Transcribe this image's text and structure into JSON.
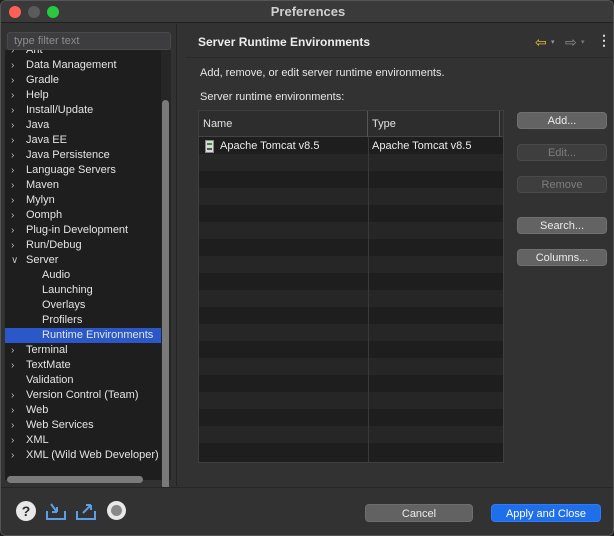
{
  "window": {
    "title": "Preferences"
  },
  "filter": {
    "placeholder": "type filter text"
  },
  "tree": {
    "items": [
      {
        "label": "Ant",
        "expandable": true,
        "level": 0
      },
      {
        "label": "Data Management",
        "expandable": true,
        "level": 0
      },
      {
        "label": "Gradle",
        "expandable": true,
        "level": 0
      },
      {
        "label": "Help",
        "expandable": true,
        "level": 0
      },
      {
        "label": "Install/Update",
        "expandable": true,
        "level": 0
      },
      {
        "label": "Java",
        "expandable": true,
        "level": 0
      },
      {
        "label": "Java EE",
        "expandable": true,
        "level": 0
      },
      {
        "label": "Java Persistence",
        "expandable": true,
        "level": 0
      },
      {
        "label": "Language Servers",
        "expandable": true,
        "level": 0
      },
      {
        "label": "Maven",
        "expandable": true,
        "level": 0
      },
      {
        "label": "Mylyn",
        "expandable": true,
        "level": 0
      },
      {
        "label": "Oomph",
        "expandable": true,
        "level": 0
      },
      {
        "label": "Plug-in Development",
        "expandable": true,
        "level": 0
      },
      {
        "label": "Run/Debug",
        "expandable": true,
        "level": 0
      },
      {
        "label": "Server",
        "expandable": true,
        "expanded": true,
        "level": 0
      },
      {
        "label": "Audio",
        "expandable": false,
        "level": 1
      },
      {
        "label": "Launching",
        "expandable": false,
        "level": 1
      },
      {
        "label": "Overlays",
        "expandable": false,
        "level": 1
      },
      {
        "label": "Profilers",
        "expandable": false,
        "level": 1
      },
      {
        "label": "Runtime Environments",
        "expandable": false,
        "level": 1,
        "selected": true
      },
      {
        "label": "Terminal",
        "expandable": true,
        "level": 0
      },
      {
        "label": "TextMate",
        "expandable": true,
        "level": 0
      },
      {
        "label": "Validation",
        "expandable": false,
        "level": 0
      },
      {
        "label": "Version Control (Team)",
        "expandable": true,
        "level": 0
      },
      {
        "label": "Web",
        "expandable": true,
        "level": 0
      },
      {
        "label": "Web Services",
        "expandable": true,
        "level": 0
      },
      {
        "label": "XML",
        "expandable": true,
        "level": 0
      },
      {
        "label": "XML (Wild Web Developer)",
        "expandable": true,
        "level": 0
      }
    ]
  },
  "page": {
    "title": "Server Runtime Environments",
    "description": "Add, remove, or edit server runtime environments.",
    "list_label": "Server runtime environments:",
    "columns": [
      "Name",
      "Type"
    ],
    "rows": [
      {
        "name": "Apache Tomcat v8.5",
        "type": "Apache Tomcat v8.5"
      }
    ],
    "buttons": {
      "add": "Add...",
      "edit": "Edit...",
      "remove": "Remove",
      "search": "Search...",
      "columns": "Columns..."
    }
  },
  "nav": {
    "back_icon": "back-arrow-icon",
    "forward_icon": "forward-arrow-icon",
    "menu_icon": "view-menu-icon"
  },
  "footer": {
    "cancel": "Cancel",
    "apply_close": "Apply and Close",
    "icons": [
      "help-icon",
      "import-icon",
      "export-icon",
      "record-icon"
    ]
  },
  "colors": {
    "accent": "#1f6feb",
    "selection": "#2a58c8",
    "back_arrow": "#e7c03c"
  }
}
